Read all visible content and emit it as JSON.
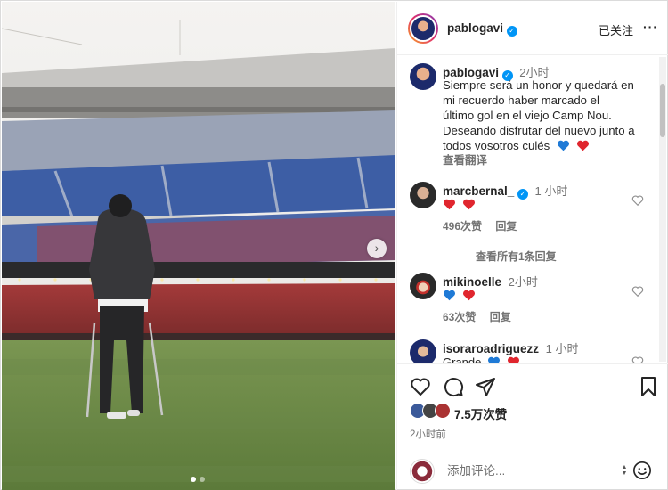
{
  "post": {
    "username": "pablogavi",
    "follow_label": "已关注",
    "more_label": "···",
    "caption_time": "2小时",
    "caption_lines": [
      "Siempre será un honor y quedará en",
      "mi recuerdo haber marcado el",
      "último gol en el viejo Camp Nou.",
      "Deseando disfrutar del nuevo junto a",
      "todos vosotros culés"
    ],
    "see_translation": "查看翻译",
    "caption_emoji": [
      "blue-heart",
      "red-heart"
    ]
  },
  "comments": [
    {
      "username": "marcbernal_",
      "verified": true,
      "time": "1 小时",
      "emoji": [
        "red-heart",
        "red-heart"
      ],
      "likes": "496次赞",
      "reply_label": "回复",
      "view_replies": "查看所有1条回复"
    },
    {
      "username": "mikinoelle",
      "verified": false,
      "time": "2小时",
      "emoji": [
        "blue-heart",
        "red-heart"
      ],
      "likes": "63次赞",
      "reply_label": "回复"
    },
    {
      "username": "isoraroadriguezz",
      "verified": false,
      "time": "1 小时",
      "text": "Grande",
      "emoji": [
        "blue-heart",
        "red-heart"
      ]
    }
  ],
  "actions": {
    "likes_count": "7.5万次赞",
    "post_time": "2小时前"
  },
  "add_comment": {
    "placeholder": "添加评论..."
  },
  "carousel": {
    "current": 1,
    "total": 2,
    "next_symbol": "›"
  },
  "colors": {
    "blue_heart": "#1f7ad6",
    "red_heart": "#e0262e",
    "verified": "#0095f6",
    "grass": "#6f8b48",
    "seats_blue": "#3a5fa8",
    "seats_red": "#b23a3a"
  }
}
